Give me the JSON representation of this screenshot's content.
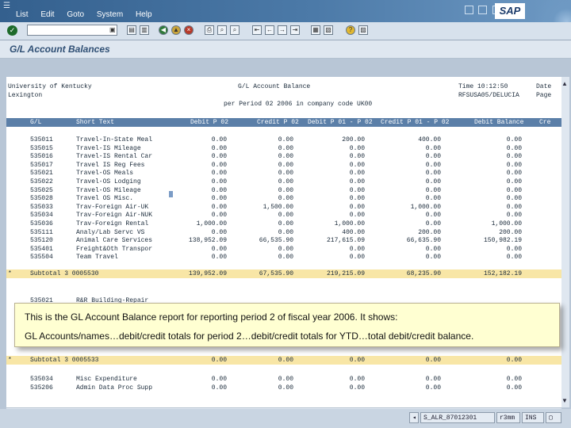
{
  "window": {
    "icon": "☰",
    "menu": [
      "List",
      "Edit",
      "Goto",
      "System",
      "Help"
    ],
    "logo": "SAP"
  },
  "toolbar": {
    "command_value": "",
    "icons": [
      "ok-icon",
      "dropdown-icon",
      "save-icon",
      "back-icon",
      "exit-icon",
      "cancel-icon",
      "print-icon",
      "find-icon",
      "find-next-icon",
      "first-page-icon",
      "prev-page-icon",
      "next-page-icon",
      "last-page-icon",
      "create-session-icon",
      "shortcut-icon",
      "help-icon",
      "layout-icon"
    ]
  },
  "app_title": "G/L Account Balances",
  "report": {
    "org1": "University of Kentucky",
    "org2": "Lexington",
    "title": "G/L Account Balance",
    "subtitle": "per Period 02 2006 in company code UK00",
    "time_label": "Time 10:12:50",
    "user": "RFSUSA05/DELUCIA",
    "date_label": "Date",
    "page_label": "Page",
    "columns": [
      "G/L",
      "Short Text",
      "Debit P 02",
      "Credit P 02",
      "Debit P 01 - P 02",
      "Credit P 01 - P 02",
      "Debit Balance",
      "Cre"
    ],
    "rows": [
      {
        "gl": "535011",
        "text": "Travel-In-State Meal",
        "d": "0.00",
        "c": "0.00",
        "dy": "200.00",
        "cy": "400.00",
        "bal": "0.00"
      },
      {
        "gl": "535015",
        "text": "Travel-IS Mileage",
        "d": "0.00",
        "c": "0.00",
        "dy": "0.00",
        "cy": "0.00",
        "bal": "0.00"
      },
      {
        "gl": "535016",
        "text": "Travel-IS Rental Car",
        "d": "0.00",
        "c": "0.00",
        "dy": "0.00",
        "cy": "0.00",
        "bal": "0.00"
      },
      {
        "gl": "535017",
        "text": "Travel IS Reg Fees",
        "d": "0.00",
        "c": "0.00",
        "dy": "0.00",
        "cy": "0.00",
        "bal": "0.00"
      },
      {
        "gl": "535021",
        "text": "Travel-OS Meals",
        "d": "0.00",
        "c": "0.00",
        "dy": "0.00",
        "cy": "0.00",
        "bal": "0.00"
      },
      {
        "gl": "535022",
        "text": "Travel-OS Lodging",
        "d": "0.00",
        "c": "0.00",
        "dy": "0.00",
        "cy": "0.00",
        "bal": "0.00"
      },
      {
        "gl": "535025",
        "text": "Travel-OS Mileage",
        "d": "0.00",
        "c": "0.00",
        "dy": "0.00",
        "cy": "0.00",
        "bal": "0.00"
      },
      {
        "gl": "535028",
        "text": "Travel OS Misc.",
        "d": "0.00",
        "c": "0.00",
        "dy": "0.00",
        "cy": "0.00",
        "bal": "0.00"
      },
      {
        "gl": "535033",
        "text": "Trav-Foreign Air-UK",
        "d": "0.00",
        "c": "1,500.00",
        "dy": "0.00",
        "cy": "1,000.00",
        "bal": "0.00"
      },
      {
        "gl": "535034",
        "text": "Trav-Foreign Air-NUK",
        "d": "0.00",
        "c": "0.00",
        "dy": "0.00",
        "cy": "0.00",
        "bal": "0.00"
      },
      {
        "gl": "535036",
        "text": "Trav-Foreign Rental",
        "d": "1,000.00",
        "c": "0.00",
        "dy": "1,000.00",
        "cy": "0.00",
        "bal": "1,000.00"
      },
      {
        "gl": "535111",
        "text": "Analy/Lab Servc VS",
        "d": "0.00",
        "c": "0.00",
        "dy": "400.00",
        "cy": "200.00",
        "bal": "200.00"
      },
      {
        "gl": "535120",
        "text": "Animal Care Services",
        "d": "138,952.09",
        "c": "66,535.90",
        "dy": "217,615.09",
        "cy": "66,635.90",
        "bal": "150,982.19"
      },
      {
        "gl": "535401",
        "text": "Freight&Oth Transpor",
        "d": "0.00",
        "c": "0.00",
        "dy": "0.00",
        "cy": "0.00",
        "bal": "0.00"
      },
      {
        "gl": "535504",
        "text": "Team Travel",
        "d": "0.00",
        "c": "0.00",
        "dy": "0.00",
        "cy": "0.00",
        "bal": "0.00"
      }
    ],
    "subtotal1": {
      "star": "*",
      "label": "Subtotal 3 0005530",
      "d": "139,952.09",
      "c": "67,535.90",
      "dy": "219,215.09",
      "cy": "68,235.90",
      "bal": "152,182.19"
    },
    "hidden_rows": [
      {
        "gl": "535021",
        "text": "R&R Building-Repair"
      }
    ],
    "subtotal2": {
      "star": "*",
      "label": "Subtotal 3 0005533",
      "d": "0.00",
      "c": "0.00",
      "dy": "0.00",
      "cy": "0.00",
      "bal": "0.00"
    },
    "bottom_rows": [
      {
        "gl": "535034",
        "text": "Misc Expenditure",
        "d": "0.00",
        "c": "0.00",
        "dy": "0.00",
        "cy": "0.00",
        "bal": "0.00"
      },
      {
        "gl": "535206",
        "text": "Admin Data Proc Supp",
        "d": "0.00",
        "c": "0.00",
        "dy": "0.00",
        "cy": "0.00",
        "bal": "0.00"
      }
    ]
  },
  "callout": {
    "line1": "This is the GL Account Balance report for reporting period 2 of fiscal year 2006. It shows:",
    "line2": "GL Accounts/names…debit/credit totals for period 2…debit/credit totals for YTD…total debit/credit balance."
  },
  "status": {
    "system": "S_ALR_87012301",
    "server": "r3mm",
    "mode": "INS"
  },
  "colors": {
    "header_blue": "#5b7fa8",
    "subtotal_yellow": "#f8e6a6",
    "callout_yellow": "#ffffd2"
  }
}
